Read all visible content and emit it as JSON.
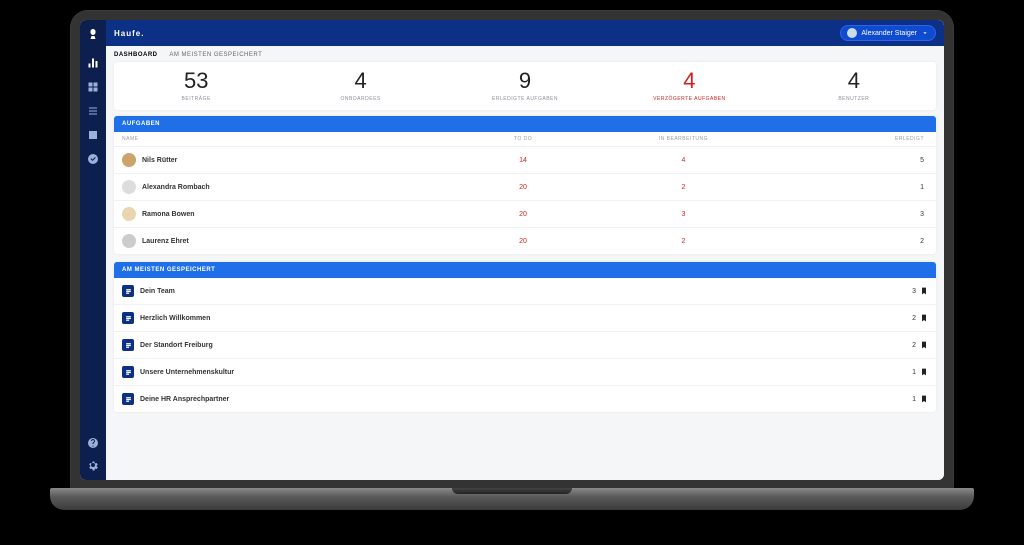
{
  "brand": "Haufe.",
  "user": {
    "name": "Alexander Staiger"
  },
  "tabs": {
    "dashboard": "Dashboard",
    "saved": "Am meisten gespeichert"
  },
  "stats": [
    {
      "value": "53",
      "label": "Beiträge",
      "danger": false
    },
    {
      "value": "4",
      "label": "Onboardees",
      "danger": false
    },
    {
      "value": "9",
      "label": "Erledigte Aufgaben",
      "danger": false
    },
    {
      "value": "4",
      "label": "Verzögerte Aufgaben",
      "danger": true
    },
    {
      "value": "4",
      "label": "Benutzer",
      "danger": false
    }
  ],
  "tasks": {
    "title": "Aufgaben",
    "columns": {
      "name": "Name",
      "todo": "To Do",
      "in_progress": "In Bearbeitung",
      "done": "Erledigt"
    },
    "rows": [
      {
        "name": "Nils Rütter",
        "todo": "14",
        "in_progress": "4",
        "done": "5"
      },
      {
        "name": "Alexandra Rombach",
        "todo": "20",
        "in_progress": "2",
        "done": "1"
      },
      {
        "name": "Ramona Bowen",
        "todo": "20",
        "in_progress": "3",
        "done": "3"
      },
      {
        "name": "Laurenz Ehret",
        "todo": "20",
        "in_progress": "2",
        "done": "2"
      }
    ]
  },
  "saved": {
    "title": "Am meisten gespeichert",
    "rows": [
      {
        "title": "Dein Team",
        "count": "3"
      },
      {
        "title": "Herzlich Willkommen",
        "count": "2"
      },
      {
        "title": "Der Standort Freiburg",
        "count": "2"
      },
      {
        "title": "Unsere Unternehmenskultur",
        "count": "1"
      },
      {
        "title": "Deine HR Ansprechpartner",
        "count": "1"
      }
    ]
  },
  "sidebar_icons": [
    "logo",
    "chart",
    "grid",
    "list",
    "image",
    "check"
  ],
  "sidebar_bottom": [
    "help",
    "settings"
  ]
}
